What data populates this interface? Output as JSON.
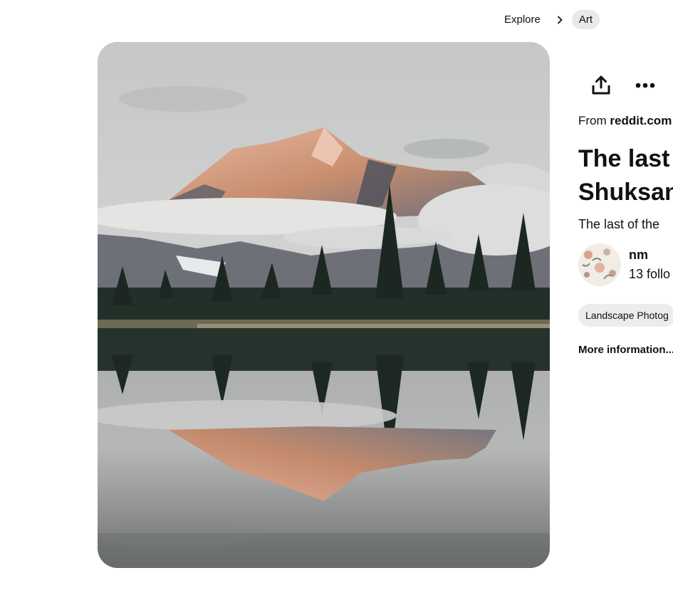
{
  "breadcrumb": {
    "items": [
      {
        "label": "Explore"
      },
      {
        "label": "Art"
      }
    ],
    "separator_icon": "chevron-right-icon"
  },
  "pin": {
    "image_alt": "Snow-capped mountain peak reflected in a still lake with pine trees",
    "source_prefix": "From",
    "source_domain": "reddit.com",
    "title_line1": "The last",
    "title_line2": "Shuksan",
    "description": "The last of the",
    "creator": {
      "name": "nm",
      "followers": "13 follo"
    },
    "tag": "Landscape Photog",
    "more_info": "More information..."
  },
  "actions": {
    "share_icon": "share-upload-icon",
    "more_icon": "more-options-icon"
  },
  "colors": {
    "text": "#111111",
    "chip_bg": "#e9e9e9",
    "tag_bg": "#ececec",
    "sky": "#c8c9ca",
    "peak_glow": "#d49a7c",
    "forest": "#1f2b24"
  }
}
